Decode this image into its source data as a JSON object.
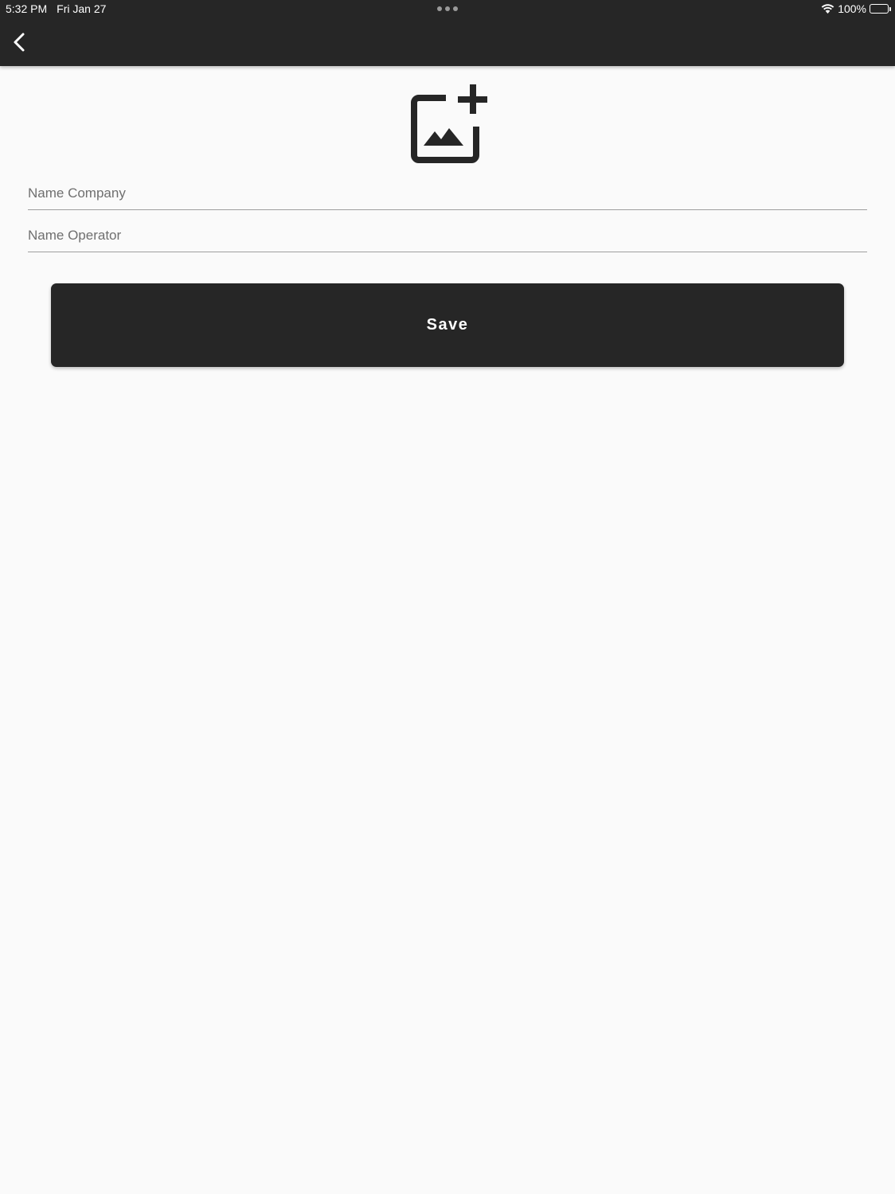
{
  "status_bar": {
    "time": "5:32 PM",
    "date": "Fri Jan 27",
    "battery": "100%",
    "icons": [
      "wifi-icon",
      "battery-icon"
    ]
  },
  "app_bar": {
    "back_icon": "chevron-left-icon"
  },
  "form": {
    "image_icon": "add-photo-icon",
    "company_placeholder": "Name Company",
    "company_value": "",
    "operator_placeholder": "Name Operator",
    "operator_value": "",
    "save_label": "Save"
  },
  "colors": {
    "bar": "#262626",
    "background": "#fafafa",
    "button": "#262626",
    "button_text": "#ffffff"
  }
}
